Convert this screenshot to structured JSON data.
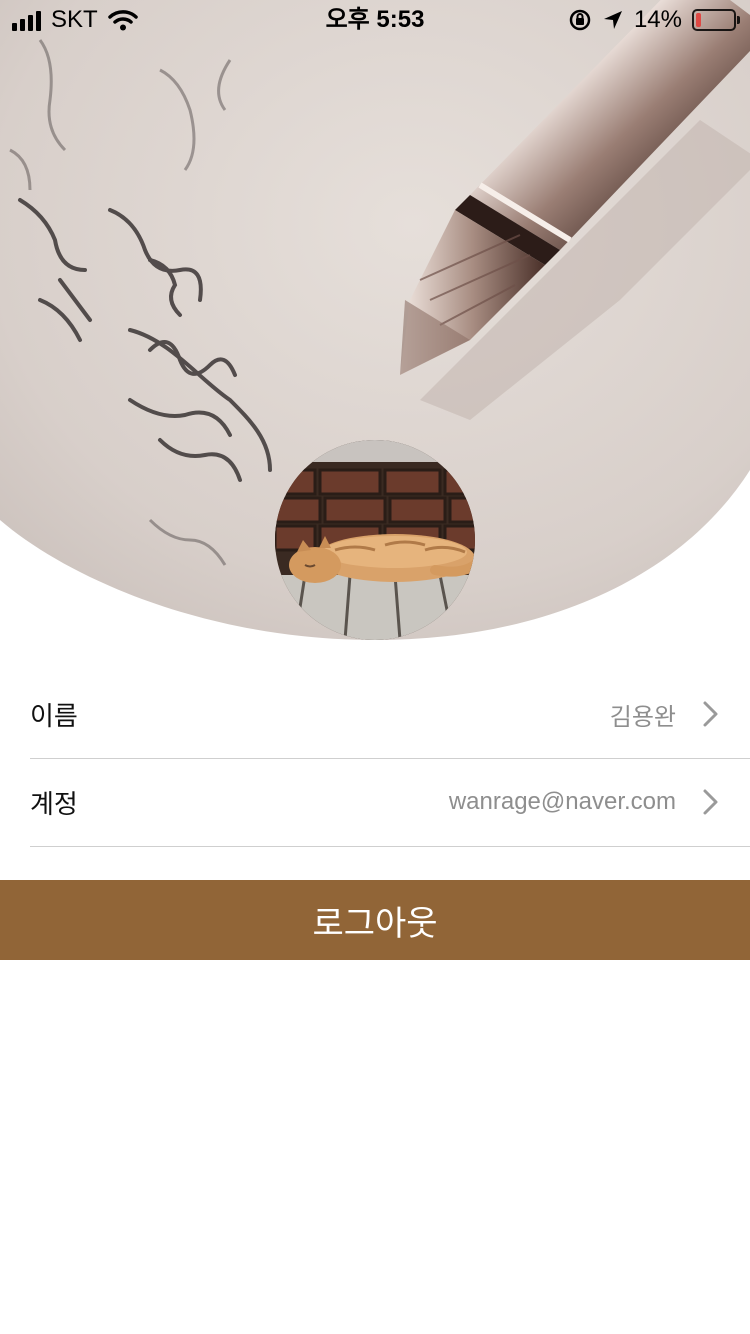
{
  "status_bar": {
    "carrier": "SKT",
    "time": "오후 5:53",
    "battery_percent": "14%",
    "battery_level": 0.14,
    "battery_color": "#e53935",
    "icons": [
      "signal-icon",
      "wifi-icon",
      "orientation-lock-icon",
      "location-arrow-icon",
      "battery-icon"
    ]
  },
  "profile": {
    "header_image": "fountain-pen-handwriting-photo",
    "avatar_image": "sleeping-cat-photo"
  },
  "rows": [
    {
      "label": "이름",
      "value": "김용완",
      "icon": "chevron-right-icon"
    },
    {
      "label": "계정",
      "value": "wanrage@naver.com",
      "icon": "chevron-right-icon"
    }
  ],
  "logout": {
    "label": "로그아웃",
    "color": "#916537"
  }
}
